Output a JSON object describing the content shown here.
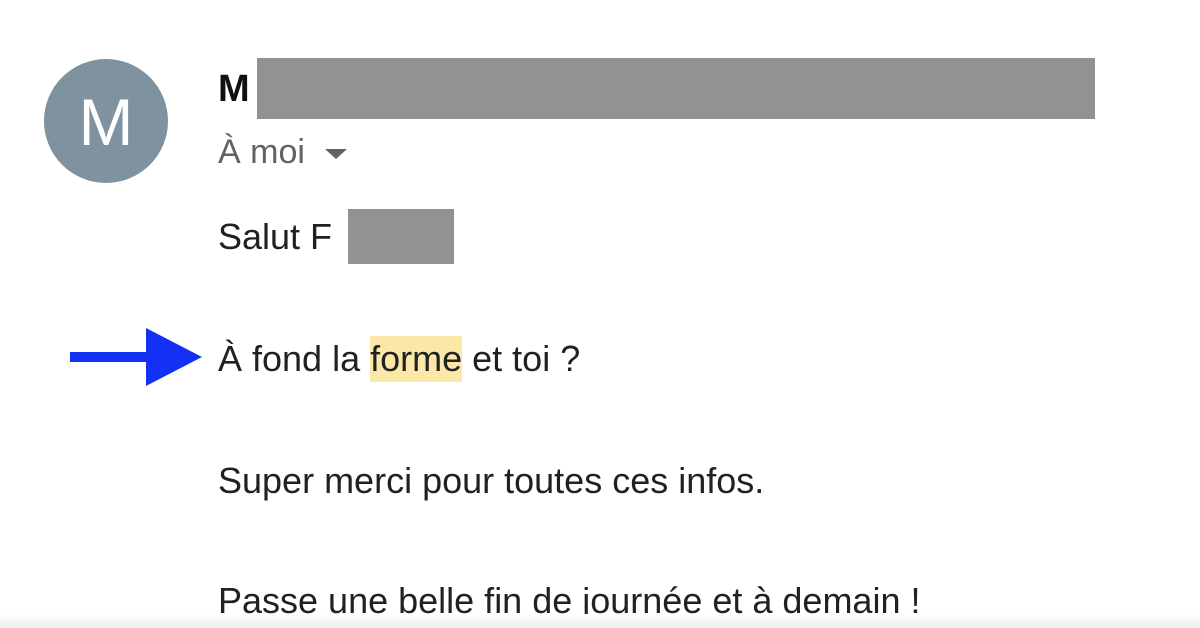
{
  "sender": {
    "avatar_letter": "M",
    "name_initial": "M"
  },
  "recipient": {
    "label": "À moi"
  },
  "message": {
    "greeting": "Salut F",
    "question_before": "À fond la ",
    "question_highlight": "forme",
    "question_after": " et toi ?",
    "thanks": "Super merci pour toutes ces infos.",
    "closing": "Passe une belle fin de journée et à demain !"
  },
  "colors": {
    "avatar": "#7e929f",
    "redaction": "#929292",
    "highlight": "#fce8a6",
    "arrow": "#1530f5"
  }
}
